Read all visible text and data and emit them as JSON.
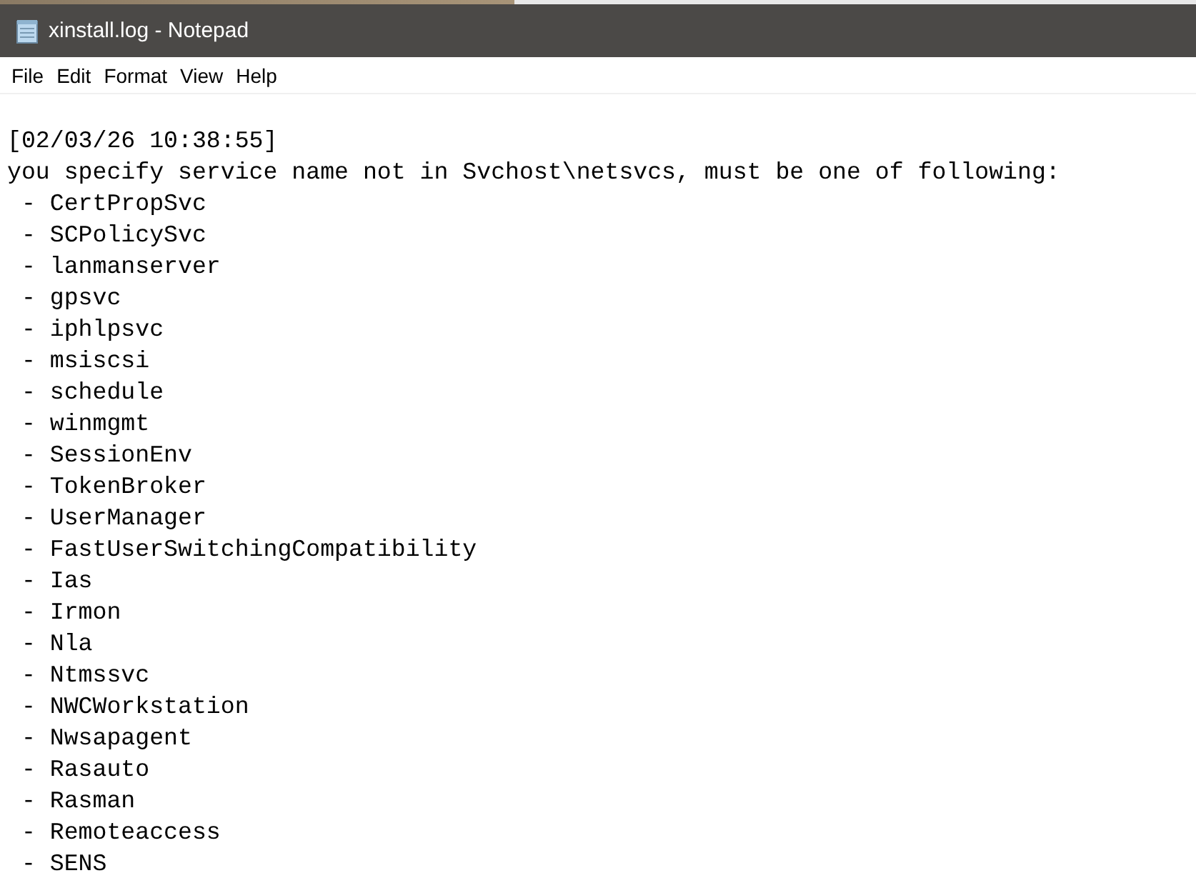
{
  "window": {
    "title": "xinstall.log - Notepad"
  },
  "menu": [
    "File",
    "Edit",
    "Format",
    "View",
    "Help"
  ],
  "document": {
    "lines": [
      "[02/03/26 10:38:55]",
      "you specify service name not in Svchost\\netsvcs, must be one of following:",
      " - CertPropSvc",
      " - SCPolicySvc",
      " - lanmanserver",
      " - gpsvc",
      " - iphlpsvc",
      " - msiscsi",
      " - schedule",
      " - winmgmt",
      " - SessionEnv",
      " - TokenBroker",
      " - UserManager",
      " - FastUserSwitchingCompatibility",
      " - Ias",
      " - Irmon",
      " - Nla",
      " - Ntmssvc",
      " - NWCWorkstation",
      " - Nwsapagent",
      " - Rasauto",
      " - Rasman",
      " - Remoteaccess",
      " - SENS"
    ]
  }
}
